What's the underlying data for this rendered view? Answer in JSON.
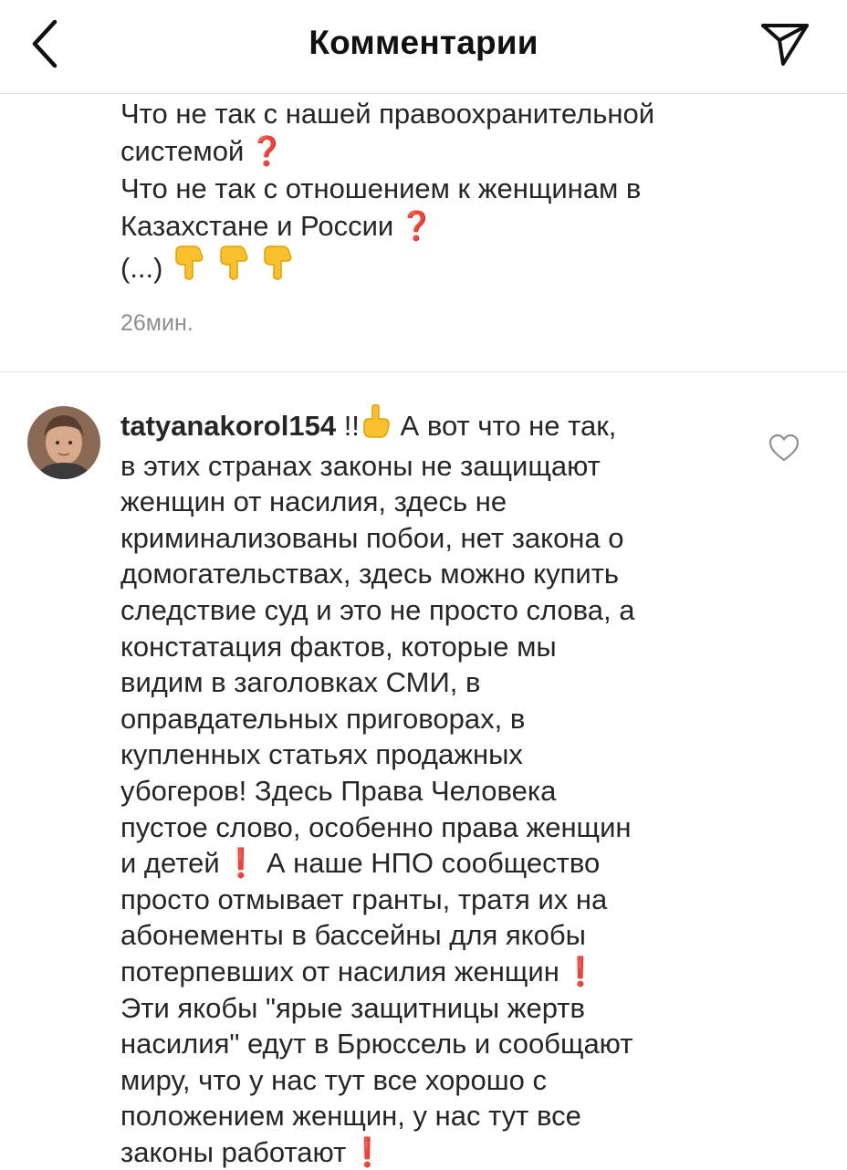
{
  "header": {
    "title": "Комментарии",
    "back_icon": "chevron-left-icon",
    "share_icon": "paper-plane-icon"
  },
  "previous_comment": {
    "lines": [
      "Что не так с нашей правоохранительной",
      "системой",
      "Что не так с отношением к женщинам в",
      "Казахстане и России",
      "(...)"
    ],
    "emoji": {
      "question": "❓",
      "pointing_down": "👇"
    },
    "time": "26мин."
  },
  "comment": {
    "username": "tatyanakorol154",
    "first_line_text": "!!",
    "first_line_rest": "А вот что не так,",
    "lines": [
      "в этих странах законы не защищают",
      "женщин от насилия, здесь не",
      "криминализованы побои, нет закона о",
      "домогательствах, здесь можно купить",
      "следствие суд и это не просто слова, а",
      "констатация фактов, которые мы",
      "видим в заголовках СМИ, в",
      "оправдательных приговорах, в",
      "купленных статьях продажных",
      "убогеров! Здесь Права Человека",
      "пустое слово, особенно права женщин"
    ],
    "line_children_start": "и детей",
    "line_children_rest": "А наше НПО сообщество",
    "lines_2": [
      "просто отмывает гранты, тратя их на",
      "абонементы в бассейны для якобы"
    ],
    "line_victims": "потерпевших от насилия женщин",
    "lines_3": [
      "Эти якобы \"ярые защитницы жертв",
      "насилия\" едут в Брюссель и сообщают",
      "миру, что у нас тут  все хорошо с",
      "положением женщин, у нас тут все"
    ],
    "line_last": "законы работают",
    "emoji": {
      "exclamation": "❗",
      "pointing_up": "👆"
    },
    "like_icon": "heart-outline-icon",
    "avatar_icon": "user-avatar"
  }
}
